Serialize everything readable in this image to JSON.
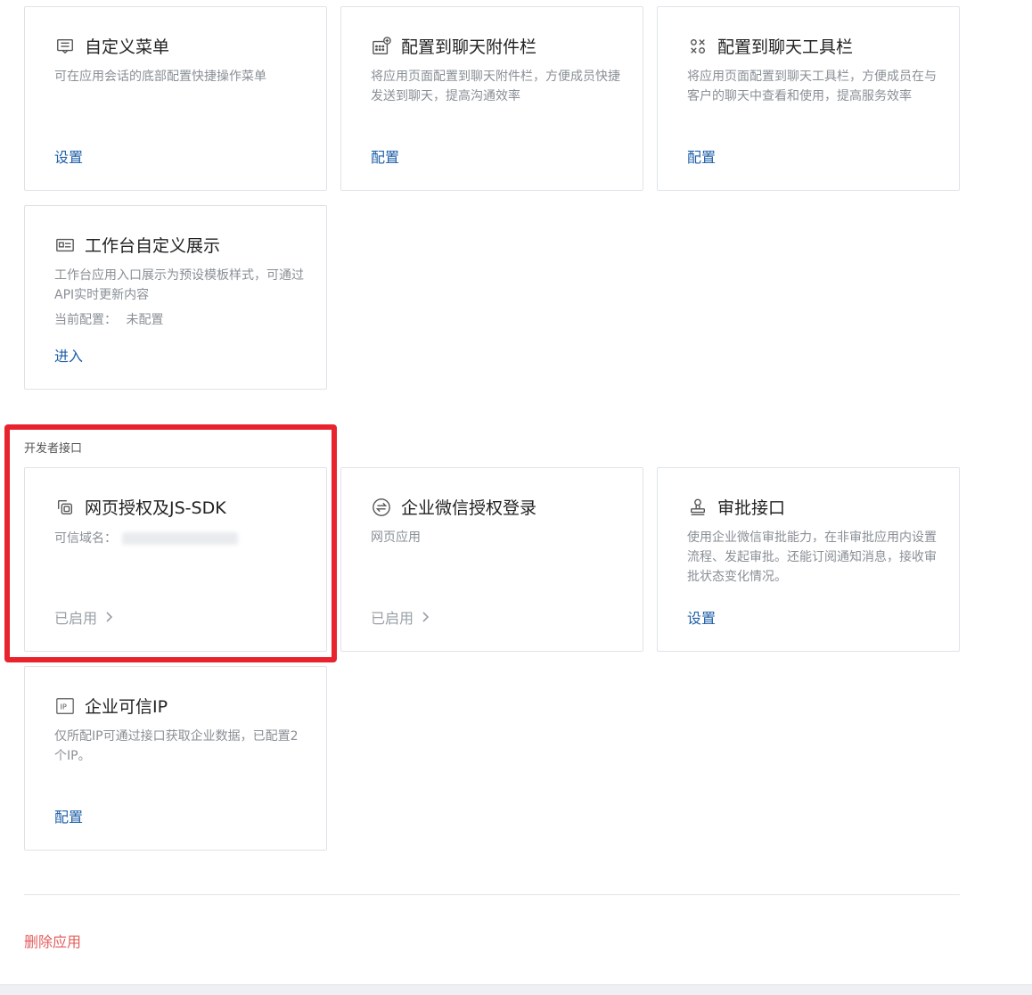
{
  "cards": {
    "custom_menu": {
      "title": "自定义菜单",
      "desc": "可在应用会话的底部配置快捷操作菜单",
      "action": "设置"
    },
    "chat_attach": {
      "title": "配置到聊天附件栏",
      "desc": "将应用页面配置到聊天附件栏，方便成员快捷发送到聊天，提高沟通效率",
      "action": "配置"
    },
    "chat_toolbar": {
      "title": "配置到聊天工具栏",
      "desc": "将应用页面配置到聊天工具栏，方便成员在与客户的聊天中查看和使用，提高服务效率",
      "action": "配置"
    },
    "workbench": {
      "title": "工作台自定义展示",
      "desc": "工作台应用入口展示为预设模板样式，可通过API实时更新内容",
      "current_label": "当前配置：",
      "current_value": "未配置",
      "action": "进入"
    }
  },
  "dev_section": {
    "label": "开发者接口",
    "web_auth": {
      "title": "网页授权及JS-SDK",
      "trusted_label": "可信域名：",
      "status": "已启用"
    },
    "wecom_login": {
      "title": "企业微信授权登录",
      "desc": "网页应用",
      "status": "已启用"
    },
    "approval": {
      "title": "审批接口",
      "desc": "使用企业微信审批能力，在非审批应用内设置流程、发起审批。还能订阅通知消息，接收审批状态变化情况。",
      "action": "设置"
    },
    "trusted_ip": {
      "title": "企业可信IP",
      "desc": "仅所配IP可通过接口获取企业数据，已配置2个IP。",
      "action": "配置"
    }
  },
  "delete_label": "删除应用",
  "icons": {
    "custom_menu": "menu-card-icon",
    "chat_attach": "grid-plus-icon",
    "chat_toolbar": "tools-icon",
    "workbench": "display-card-icon",
    "web_auth": "link-squares-icon",
    "wecom_login": "exchange-circle-icon",
    "approval": "stamp-icon",
    "trusted_ip": "ip-box-icon",
    "chevron": "chevron-right-icon"
  },
  "colors": {
    "link": "#1f5fa8",
    "danger": "#e35d5d",
    "highlight": "#e8232d",
    "muted": "#9aa0a6"
  }
}
